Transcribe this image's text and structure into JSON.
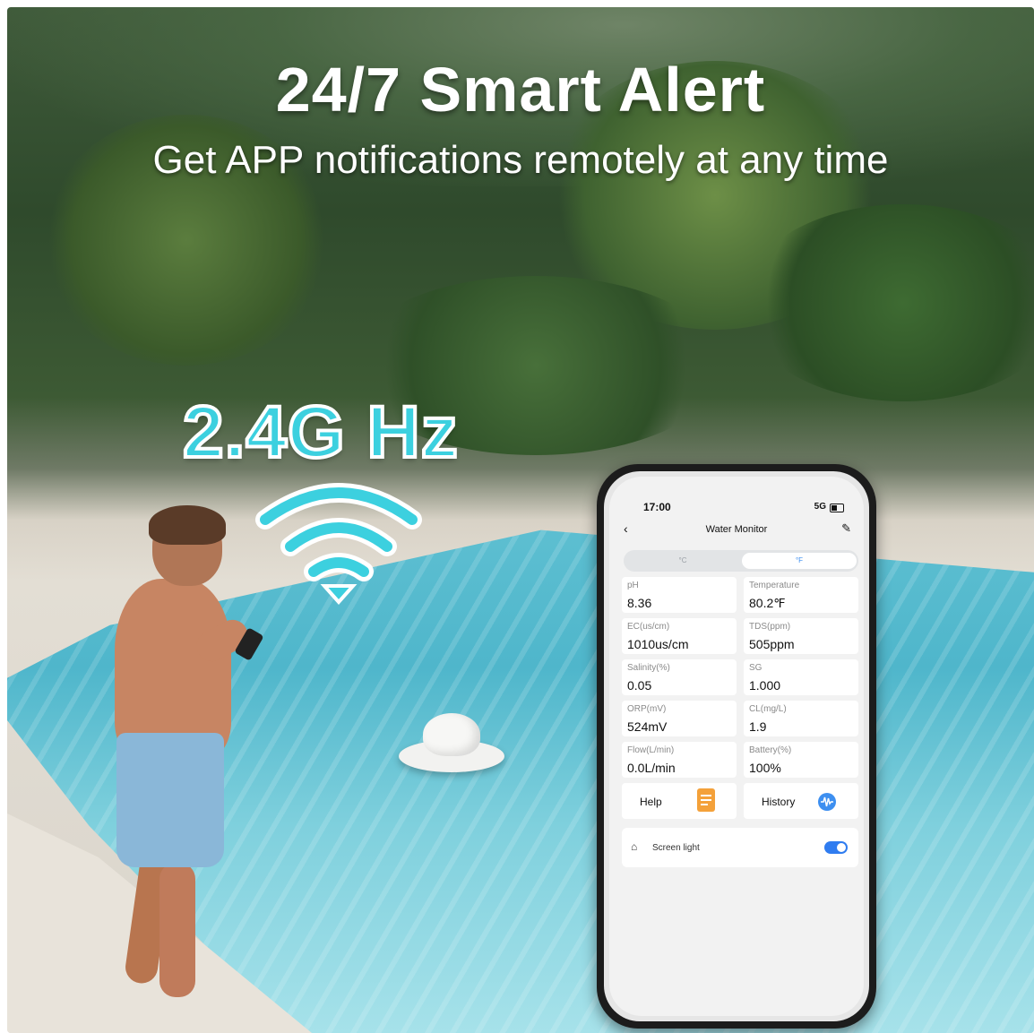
{
  "banner": {
    "headline": "24/7 Smart Alert",
    "subline": "Get APP notifications remotely at any time",
    "frequency": "2.4G Hz"
  },
  "icons": {
    "wifi": "wifi-icon",
    "help": "document-icon",
    "history": "waveform-icon",
    "screen_light": "lamp-icon",
    "back": "chevron-left-icon",
    "edit": "pencil-icon"
  },
  "colors": {
    "accent": "#3cd0df",
    "app_blue": "#2f7cf0",
    "help_orange": "#f4a13a"
  },
  "phone": {
    "status": {
      "time": "17:00",
      "signal": "5G"
    },
    "app": {
      "title": "Water Monitor",
      "units": {
        "celsius": "°C",
        "fahrenheit": "°F",
        "selected": "°F"
      },
      "readings": [
        {
          "label": "pH",
          "value": "8.36"
        },
        {
          "label": "Temperature",
          "value": "80.2℉"
        },
        {
          "label": "EC(us/cm)",
          "value": "1010us/cm"
        },
        {
          "label": "TDS(ppm)",
          "value": "505ppm"
        },
        {
          "label": "Salinity(%)",
          "value": "0.05"
        },
        {
          "label": "SG",
          "value": "1.000"
        },
        {
          "label": "ORP(mV)",
          "value": "524mV"
        },
        {
          "label": "CL(mg/L)",
          "value": "1.9"
        },
        {
          "label": "Flow(L/min)",
          "value": "0.0L/min"
        },
        {
          "label": "Battery(%)",
          "value": "100%"
        }
      ],
      "actions": {
        "help": "Help",
        "history": "History"
      },
      "settings": {
        "screen_light": "Screen light",
        "screen_light_on": true
      }
    }
  }
}
